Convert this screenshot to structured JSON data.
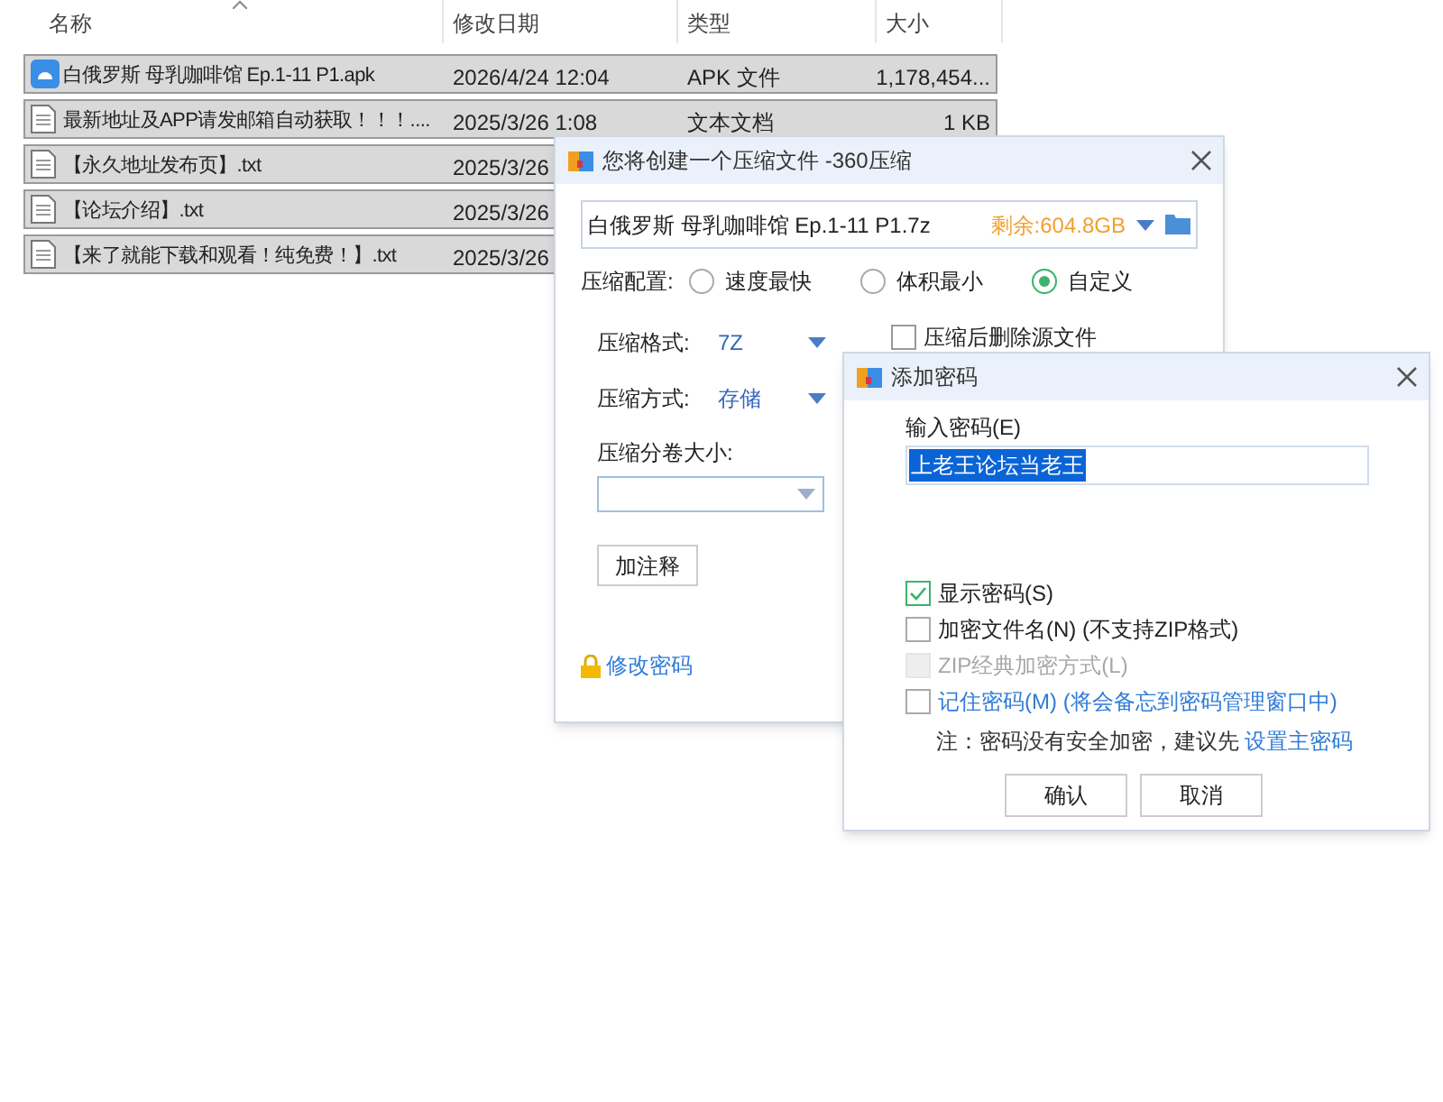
{
  "explorer": {
    "columns": [
      "名称",
      "修改日期",
      "类型",
      "大小"
    ],
    "rows": [
      {
        "kind": "apk",
        "name": "白俄罗斯 母乳咖啡馆 Ep.1-11 P1.apk",
        "date": "2026/4/24 12:04",
        "type": "APK 文件",
        "size": "1,178,454...",
        "selected": true
      },
      {
        "kind": "txt",
        "name": "最新地址及APP请发邮箱自动获取！！！....",
        "date": "2025/3/26 1:08",
        "type": "文本文档",
        "size": "1 KB",
        "selected": true
      },
      {
        "kind": "txt",
        "name": "【永久地址发布页】.txt",
        "date": "2025/3/26",
        "selected": true
      },
      {
        "kind": "txt",
        "name": "【论坛介绍】.txt",
        "date": "2025/3/26",
        "selected": true
      },
      {
        "kind": "txt",
        "name": "【来了就能下载和观看！纯免费！】.txt",
        "date": "2025/3/26",
        "selected": true
      }
    ]
  },
  "compress_dialog": {
    "title": "您将创建一个压缩文件 -360压缩",
    "filename": "白俄罗斯 母乳咖啡馆 Ep.1-11 P1.7z",
    "free_space": "剩余:604.8GB",
    "config_label": "压缩配置:",
    "presets": [
      {
        "label": "速度最快",
        "selected": false
      },
      {
        "label": "体积最小",
        "selected": false
      },
      {
        "label": "自定义",
        "selected": true
      }
    ],
    "format_label": "压缩格式:",
    "format_value": "7Z",
    "method_label": "压缩方式:",
    "method_value": "存储",
    "delete_source": {
      "label": "压缩后删除源文件",
      "checked": false
    },
    "volume_label": "压缩分卷大小:",
    "comment_button": "加注释",
    "change_password": "修改密码"
  },
  "password_dialog": {
    "title": "添加密码",
    "input_label": "输入密码(E)",
    "password": "上老王论坛当老王",
    "options": [
      {
        "kind": "normal",
        "label": "显示密码(S)",
        "checked": true,
        "disabled": false
      },
      {
        "kind": "normal",
        "label": "加密文件名(N) (不支持ZIP格式)",
        "checked": false,
        "disabled": false
      },
      {
        "kind": "normal",
        "label": "ZIP经典加密方式(L)",
        "checked": false,
        "disabled": true
      },
      {
        "kind": "link",
        "label": "记住密码(M) (将会备忘到密码管理窗口中)",
        "checked": false,
        "disabled": false
      }
    ],
    "note": "注：密码没有安全加密，建议先",
    "note_link": "设置主密码",
    "buttons": [
      "确认",
      "取消"
    ]
  }
}
